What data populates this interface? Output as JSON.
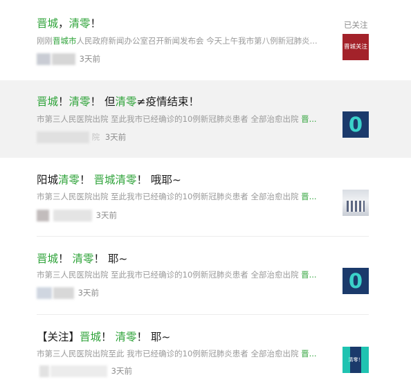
{
  "follow_label": "已关注",
  "colors": {
    "keyword": "#2fa33a",
    "highlight_bg": "#f2f2f2"
  },
  "articles": [
    {
      "title": [
        {
          "t": "晋城",
          "g": true
        },
        {
          "t": "，",
          "g": false
        },
        {
          "t": "清零",
          "g": true
        },
        {
          "t": "！",
          "g": false
        }
      ],
      "summary": [
        {
          "t": "刚刚",
          "g": false
        },
        {
          "t": "晋城市",
          "g": true
        },
        {
          "t": "人民政府新闻办公室召开新闻发布会 今天上午我市第八例新冠肺炎...",
          "g": false
        }
      ],
      "time": "3天前",
      "thumb_text": "晋城关注"
    },
    {
      "title": [
        {
          "t": "晋城",
          "g": true
        },
        {
          "t": "！",
          "g": false
        },
        {
          "t": "清零",
          "g": true
        },
        {
          "t": "！ 但",
          "g": false
        },
        {
          "t": "清零",
          "g": true
        },
        {
          "t": "≠疫情结束！",
          "g": false
        }
      ],
      "summary": [
        {
          "t": "市第三人民医院出院 至此我市已经确诊的10例新冠肺炎患者 全部治愈出院 ",
          "g": false
        },
        {
          "t": "晋...",
          "g": true
        }
      ],
      "source_fragment": "院",
      "time": "3天前",
      "thumb_text": "0"
    },
    {
      "title": [
        {
          "t": "阳城",
          "g": false
        },
        {
          "t": "清零",
          "g": true
        },
        {
          "t": "！ ",
          "g": false
        },
        {
          "t": "晋城清零",
          "g": true
        },
        {
          "t": "！ 哦耶~",
          "g": false
        }
      ],
      "summary": [
        {
          "t": "市第三人民医院出院 至此我市已经确诊的10例新冠肺炎患者 全部治愈出院 ",
          "g": false
        },
        {
          "t": "晋...",
          "g": true
        }
      ],
      "time": "3天前"
    },
    {
      "title": [
        {
          "t": "晋城",
          "g": true
        },
        {
          "t": "！ ",
          "g": false
        },
        {
          "t": "清零",
          "g": true
        },
        {
          "t": "！ 耶~",
          "g": false
        }
      ],
      "summary": [
        {
          "t": "市第三人民医院出院 至此我市已经确诊的10例新冠肺炎患者 全部治愈出院 ",
          "g": false
        },
        {
          "t": "晋...",
          "g": true
        }
      ],
      "time": "3天前",
      "thumb_text": "0"
    },
    {
      "title": [
        {
          "t": "【关注】",
          "g": false
        },
        {
          "t": "晋城",
          "g": true
        },
        {
          "t": "！ ",
          "g": false
        },
        {
          "t": "清零",
          "g": true
        },
        {
          "t": "！ 耶~",
          "g": false
        }
      ],
      "summary": [
        {
          "t": "市第三人民医院出院至此 我市已经确诊的10例新冠肺炎患者 全部治愈出院 ",
          "g": false
        },
        {
          "t": "晋...",
          "g": true
        }
      ],
      "time": "3天前",
      "thumb_text": "清零！"
    }
  ]
}
